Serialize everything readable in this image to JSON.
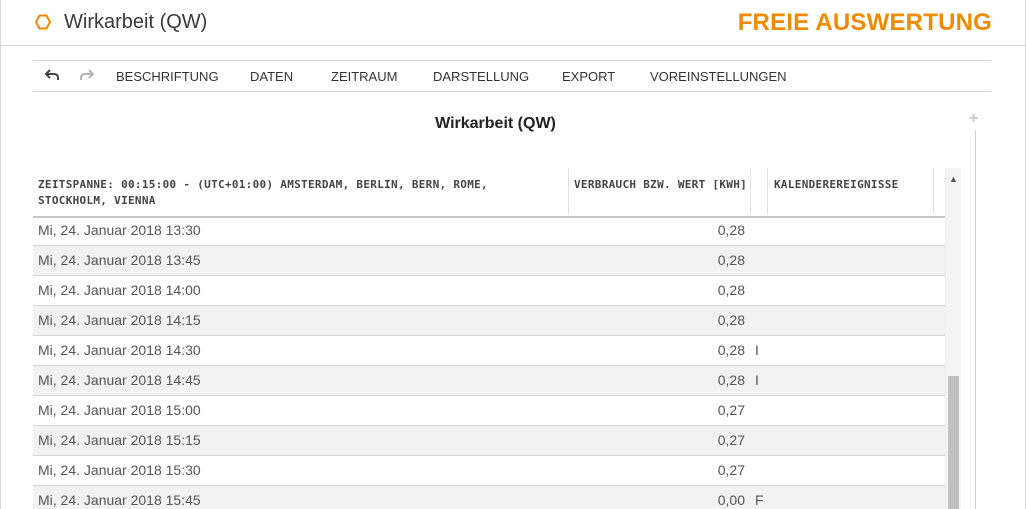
{
  "header": {
    "title": "Wirkarbeit (QW)",
    "brand": "FREIE AUSWERTUNG",
    "icon": "hexagon-icon",
    "accent_color": "#f08a00"
  },
  "toolbar": {
    "undo_icon": "undo-icon",
    "redo_icon": "redo-icon",
    "items": [
      "BESCHRIFTUNG",
      "DATEN",
      "ZEITRAUM",
      "DARSTELLUNG",
      "EXPORT",
      "VOREINSTELLUNGEN"
    ]
  },
  "content": {
    "title": "Wirkarbeit (QW)",
    "plus": "+"
  },
  "table": {
    "columns": [
      "ZEITSPANNE: 00:15:00 - (UTC+01:00) AMSTERDAM, BERLIN, BERN, ROME, STOCKHOLM, VIENNA",
      "VERBRAUCH BZW. WERT [KWH]",
      "KALENDEREREIGNISSE"
    ],
    "rows": [
      {
        "time": "Mi, 24. Januar 2018 13:30",
        "value": "0,28",
        "flag": ""
      },
      {
        "time": "Mi, 24. Januar 2018 13:45",
        "value": "0,28",
        "flag": ""
      },
      {
        "time": "Mi, 24. Januar 2018 14:00",
        "value": "0,28",
        "flag": ""
      },
      {
        "time": "Mi, 24. Januar 2018 14:15",
        "value": "0,28",
        "flag": ""
      },
      {
        "time": "Mi, 24. Januar 2018 14:30",
        "value": "0,28",
        "flag": "I"
      },
      {
        "time": "Mi, 24. Januar 2018 14:45",
        "value": "0,28",
        "flag": "I"
      },
      {
        "time": "Mi, 24. Januar 2018 15:00",
        "value": "0,27",
        "flag": ""
      },
      {
        "time": "Mi, 24. Januar 2018 15:15",
        "value": "0,27",
        "flag": ""
      },
      {
        "time": "Mi, 24. Januar 2018 15:30",
        "value": "0,27",
        "flag": ""
      },
      {
        "time": "Mi, 24. Januar 2018 15:45",
        "value": "0,00",
        "flag": "F"
      }
    ]
  }
}
